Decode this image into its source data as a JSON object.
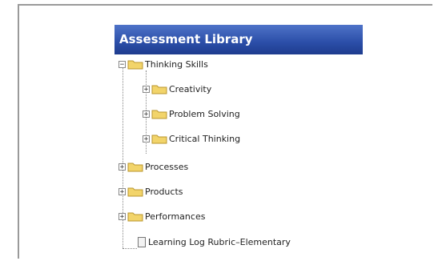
{
  "library": {
    "title": "Assessment Library",
    "tree": [
      {
        "label": "Thinking Skills",
        "toggle": "−",
        "icon": "folder-icon"
      },
      {
        "label": "Creativity",
        "toggle": "+",
        "icon": "folder-icon"
      },
      {
        "label": "Problem Solving",
        "toggle": "+",
        "icon": "folder-icon"
      },
      {
        "label": "Critical Thinking",
        "toggle": "+",
        "icon": "folder-icon"
      },
      {
        "label": "Processes",
        "toggle": "+",
        "icon": "folder-icon"
      },
      {
        "label": "Products",
        "toggle": "+",
        "icon": "folder-icon"
      },
      {
        "label": "Performances",
        "toggle": "+",
        "icon": "folder-icon"
      },
      {
        "label": "Learning Log Rubric–Elementary",
        "icon": "document-icon"
      }
    ]
  },
  "colors": {
    "title_bg": "#2b4ea8",
    "folder": "#f2d46a"
  }
}
